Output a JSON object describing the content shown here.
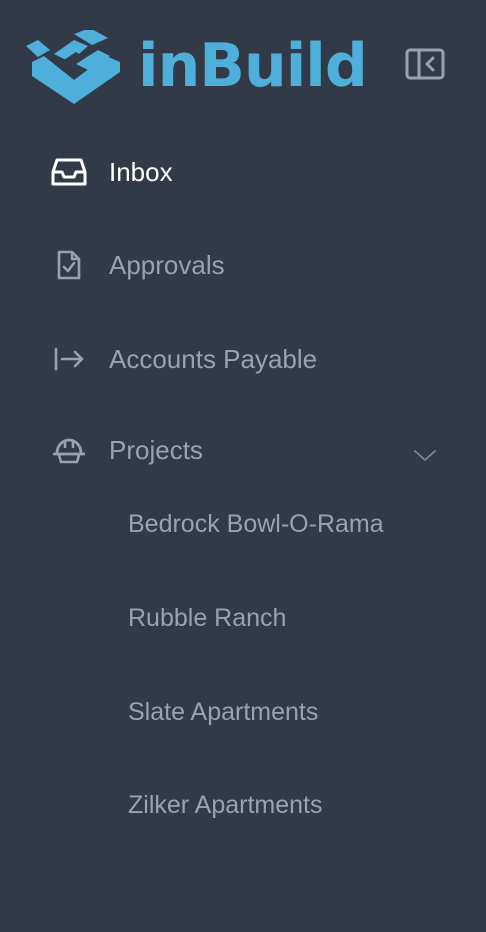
{
  "brand": {
    "name": "inBuild",
    "color": "#4dafda",
    "icon": "open-box-logo-icon"
  },
  "collapse_button": {
    "icon": "sidebar-collapse-icon"
  },
  "nav": {
    "items": [
      {
        "label": "Inbox",
        "icon": "inbox-icon",
        "active": true
      },
      {
        "label": "Approvals",
        "icon": "document-check-icon",
        "active": false
      },
      {
        "label": "Accounts Payable",
        "icon": "arrow-right-bar-icon",
        "active": false
      },
      {
        "label": "Projects",
        "icon": "hard-hat-icon",
        "active": false,
        "expanded": true
      }
    ]
  },
  "projects": {
    "items": [
      {
        "label": "Bedrock Bowl-O-Rama"
      },
      {
        "label": "Rubble Ranch"
      },
      {
        "label": "Slate Apartments"
      },
      {
        "label": "Zilker Apartments"
      }
    ]
  },
  "colors": {
    "background": "#333a47",
    "text_active": "#ffffff",
    "text_muted": "#9aa2ae"
  }
}
